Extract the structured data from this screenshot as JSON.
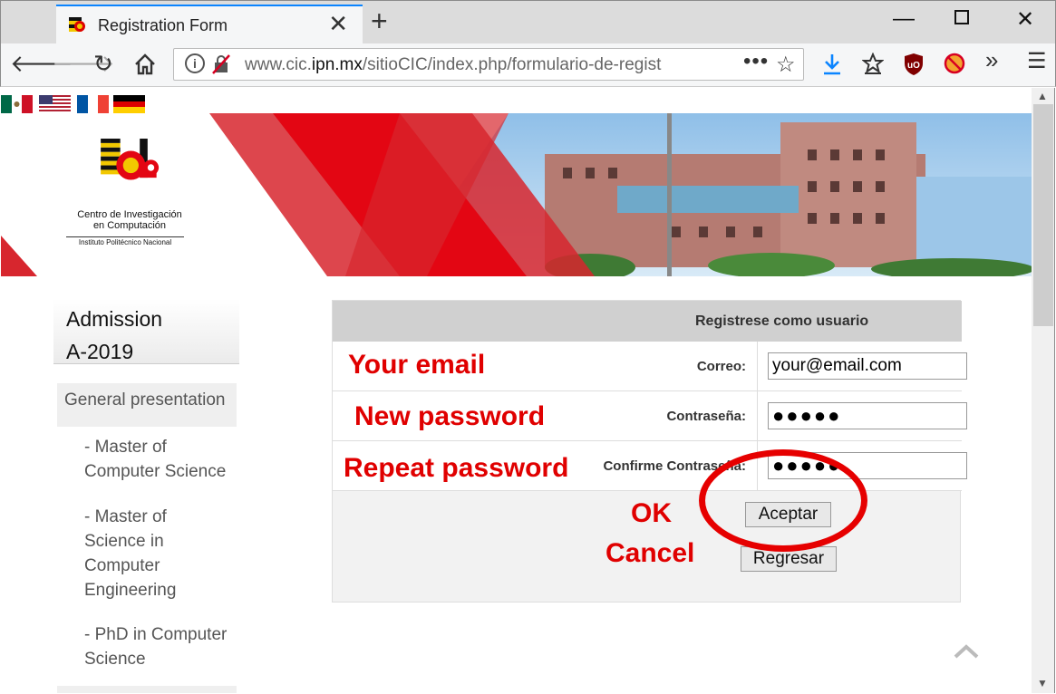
{
  "browser": {
    "tab_title": "Registration Form",
    "url_prefix": "www.cic.",
    "url_domain": "ipn.mx",
    "url_path": "/sitioCIC/index.php/formulario-de-regist",
    "page_actions": "•••"
  },
  "banner": {
    "logo_line1": "Centro de Investigación",
    "logo_line2": "en Computación",
    "logo_line3": "Instituto Politécnico Nacional"
  },
  "sidebar": {
    "title_line1": "Admission",
    "title_line2": "A-2019",
    "general": "General presentation",
    "items": [
      {
        "line1": "- Master of",
        "line2": "Computer Science"
      },
      {
        "line1": "- Master of",
        "line2": "Science in",
        "line3": "Computer",
        "line4": "Engineering"
      },
      {
        "line1": "- PhD in Computer",
        "line2": "Science"
      }
    ]
  },
  "form": {
    "header": "Registrese como usuario",
    "email_label": "Correo:",
    "email_value": "your@email.com",
    "password_label": "Contraseña:",
    "password_value": "●●●●●",
    "confirm_label": "Confirme Contraseña:",
    "confirm_value": "●●●●●",
    "accept_button": "Aceptar",
    "back_button": "Regresar"
  },
  "annotations": {
    "email": "Your email",
    "password": "New password",
    "repeat": "Repeat password",
    "ok": "OK",
    "cancel": "Cancel"
  },
  "colors": {
    "annotation_red": "#e00000",
    "banner_red": "#d7262e",
    "tab_accent": "#0a84ff"
  }
}
